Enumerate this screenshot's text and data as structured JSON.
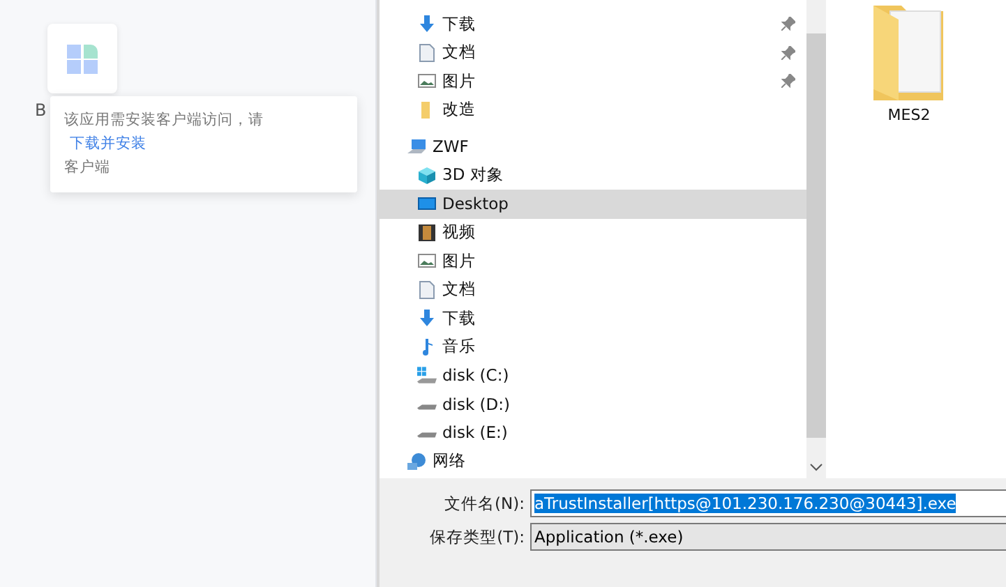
{
  "app_tile": {
    "name": "B"
  },
  "tooltip": {
    "message": "该应用需安装客户端访问，请",
    "link": "下载并安装",
    "message_end": "客户端"
  },
  "nav": {
    "quick_access": [
      {
        "label": "下载",
        "kind": "download",
        "pinned": true,
        "selected": false
      },
      {
        "label": "文档",
        "kind": "document",
        "pinned": true,
        "selected": false
      },
      {
        "label": "图片",
        "kind": "picture",
        "pinned": true,
        "selected": false
      },
      {
        "label": "改造",
        "kind": "folder",
        "pinned": false,
        "selected": false
      }
    ],
    "tree": [
      {
        "label": "ZWF",
        "kind": "pc",
        "selected": false,
        "children": [
          {
            "label": "3D 对象",
            "kind": "cube",
            "selected": false
          },
          {
            "label": "Desktop",
            "kind": "desktop",
            "selected": true
          },
          {
            "label": "视频",
            "kind": "video",
            "selected": false
          },
          {
            "label": "图片",
            "kind": "picture",
            "selected": false
          },
          {
            "label": "文档",
            "kind": "document",
            "selected": false
          },
          {
            "label": "下载",
            "kind": "download",
            "selected": false
          },
          {
            "label": "音乐",
            "kind": "music",
            "selected": false
          },
          {
            "label": "disk (C:)",
            "kind": "drive-windows",
            "selected": false
          },
          {
            "label": "disk (D:)",
            "kind": "drive",
            "selected": false
          },
          {
            "label": "disk (E:)",
            "kind": "drive",
            "selected": false
          }
        ]
      },
      {
        "label": "网络",
        "kind": "network",
        "selected": false
      }
    ]
  },
  "files": [
    {
      "name": "MES2"
    }
  ],
  "form": {
    "filename_label": "文件名(N):",
    "filename_value": "aTrustInstaller[https@101.230.176.230@30443].exe",
    "type_label": "保存类型(T):",
    "type_value": "Application (*.exe)"
  }
}
